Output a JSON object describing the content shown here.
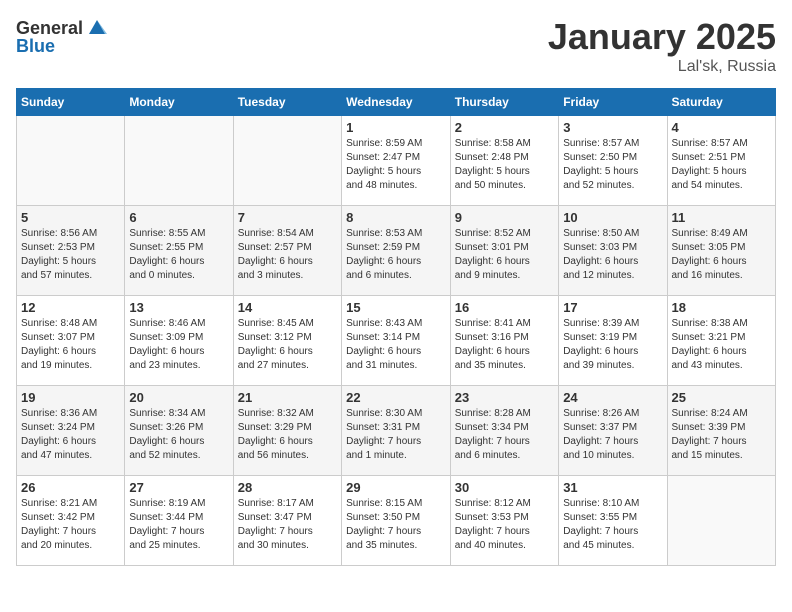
{
  "header": {
    "logo_general": "General",
    "logo_blue": "Blue",
    "month": "January 2025",
    "location": "Lal'sk, Russia"
  },
  "weekdays": [
    "Sunday",
    "Monday",
    "Tuesday",
    "Wednesday",
    "Thursday",
    "Friday",
    "Saturday"
  ],
  "weeks": [
    [
      {
        "day": "",
        "info": ""
      },
      {
        "day": "",
        "info": ""
      },
      {
        "day": "",
        "info": ""
      },
      {
        "day": "1",
        "info": "Sunrise: 8:59 AM\nSunset: 2:47 PM\nDaylight: 5 hours\nand 48 minutes."
      },
      {
        "day": "2",
        "info": "Sunrise: 8:58 AM\nSunset: 2:48 PM\nDaylight: 5 hours\nand 50 minutes."
      },
      {
        "day": "3",
        "info": "Sunrise: 8:57 AM\nSunset: 2:50 PM\nDaylight: 5 hours\nand 52 minutes."
      },
      {
        "day": "4",
        "info": "Sunrise: 8:57 AM\nSunset: 2:51 PM\nDaylight: 5 hours\nand 54 minutes."
      }
    ],
    [
      {
        "day": "5",
        "info": "Sunrise: 8:56 AM\nSunset: 2:53 PM\nDaylight: 5 hours\nand 57 minutes."
      },
      {
        "day": "6",
        "info": "Sunrise: 8:55 AM\nSunset: 2:55 PM\nDaylight: 6 hours\nand 0 minutes."
      },
      {
        "day": "7",
        "info": "Sunrise: 8:54 AM\nSunset: 2:57 PM\nDaylight: 6 hours\nand 3 minutes."
      },
      {
        "day": "8",
        "info": "Sunrise: 8:53 AM\nSunset: 2:59 PM\nDaylight: 6 hours\nand 6 minutes."
      },
      {
        "day": "9",
        "info": "Sunrise: 8:52 AM\nSunset: 3:01 PM\nDaylight: 6 hours\nand 9 minutes."
      },
      {
        "day": "10",
        "info": "Sunrise: 8:50 AM\nSunset: 3:03 PM\nDaylight: 6 hours\nand 12 minutes."
      },
      {
        "day": "11",
        "info": "Sunrise: 8:49 AM\nSunset: 3:05 PM\nDaylight: 6 hours\nand 16 minutes."
      }
    ],
    [
      {
        "day": "12",
        "info": "Sunrise: 8:48 AM\nSunset: 3:07 PM\nDaylight: 6 hours\nand 19 minutes."
      },
      {
        "day": "13",
        "info": "Sunrise: 8:46 AM\nSunset: 3:09 PM\nDaylight: 6 hours\nand 23 minutes."
      },
      {
        "day": "14",
        "info": "Sunrise: 8:45 AM\nSunset: 3:12 PM\nDaylight: 6 hours\nand 27 minutes."
      },
      {
        "day": "15",
        "info": "Sunrise: 8:43 AM\nSunset: 3:14 PM\nDaylight: 6 hours\nand 31 minutes."
      },
      {
        "day": "16",
        "info": "Sunrise: 8:41 AM\nSunset: 3:16 PM\nDaylight: 6 hours\nand 35 minutes."
      },
      {
        "day": "17",
        "info": "Sunrise: 8:39 AM\nSunset: 3:19 PM\nDaylight: 6 hours\nand 39 minutes."
      },
      {
        "day": "18",
        "info": "Sunrise: 8:38 AM\nSunset: 3:21 PM\nDaylight: 6 hours\nand 43 minutes."
      }
    ],
    [
      {
        "day": "19",
        "info": "Sunrise: 8:36 AM\nSunset: 3:24 PM\nDaylight: 6 hours\nand 47 minutes."
      },
      {
        "day": "20",
        "info": "Sunrise: 8:34 AM\nSunset: 3:26 PM\nDaylight: 6 hours\nand 52 minutes."
      },
      {
        "day": "21",
        "info": "Sunrise: 8:32 AM\nSunset: 3:29 PM\nDaylight: 6 hours\nand 56 minutes."
      },
      {
        "day": "22",
        "info": "Sunrise: 8:30 AM\nSunset: 3:31 PM\nDaylight: 7 hours\nand 1 minute."
      },
      {
        "day": "23",
        "info": "Sunrise: 8:28 AM\nSunset: 3:34 PM\nDaylight: 7 hours\nand 6 minutes."
      },
      {
        "day": "24",
        "info": "Sunrise: 8:26 AM\nSunset: 3:37 PM\nDaylight: 7 hours\nand 10 minutes."
      },
      {
        "day": "25",
        "info": "Sunrise: 8:24 AM\nSunset: 3:39 PM\nDaylight: 7 hours\nand 15 minutes."
      }
    ],
    [
      {
        "day": "26",
        "info": "Sunrise: 8:21 AM\nSunset: 3:42 PM\nDaylight: 7 hours\nand 20 minutes."
      },
      {
        "day": "27",
        "info": "Sunrise: 8:19 AM\nSunset: 3:44 PM\nDaylight: 7 hours\nand 25 minutes."
      },
      {
        "day": "28",
        "info": "Sunrise: 8:17 AM\nSunset: 3:47 PM\nDaylight: 7 hours\nand 30 minutes."
      },
      {
        "day": "29",
        "info": "Sunrise: 8:15 AM\nSunset: 3:50 PM\nDaylight: 7 hours\nand 35 minutes."
      },
      {
        "day": "30",
        "info": "Sunrise: 8:12 AM\nSunset: 3:53 PM\nDaylight: 7 hours\nand 40 minutes."
      },
      {
        "day": "31",
        "info": "Sunrise: 8:10 AM\nSunset: 3:55 PM\nDaylight: 7 hours\nand 45 minutes."
      },
      {
        "day": "",
        "info": ""
      }
    ]
  ]
}
